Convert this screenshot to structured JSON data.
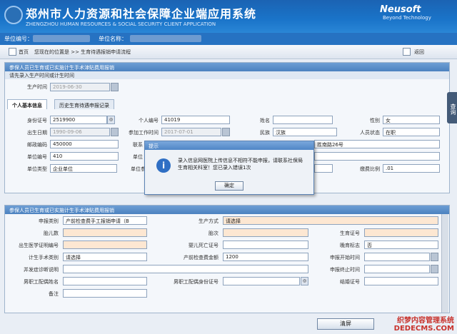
{
  "header": {
    "title_cn": "郑州市人力资源和社会保障企业端应用系统",
    "title_en": "ZHENGZHOU HUMAN RESOURCES & SOCIAL SECURITY CLIENT APPLICATION",
    "logo_name": "Neusoft",
    "logo_slogan": "Beyond Technology"
  },
  "unitbar": {
    "unit_no_label": "单位编号：",
    "unit_name_label": "单位名称："
  },
  "nav": {
    "home": "首页",
    "location": "您现在的位置是 >> 生育待遇报销申请流程",
    "back": "返回"
  },
  "top_panel": {
    "title": "参保人员已生育或已实施计生手术津贴费用报销",
    "sub": "请先录入生产时间或计生时间",
    "birth_time_label": "生产时间",
    "birth_time_value": "2019-06-30"
  },
  "tabs": {
    "basic": "个人基本信息",
    "history": "历史生育待遇申报记录"
  },
  "basic": {
    "id_label": "身份证号",
    "id_value": "2519900",
    "pno_label": "个人编号",
    "pno_value": "41019",
    "name_label": "姓名",
    "gender_label": "性别",
    "gender_value": "女",
    "dob_label": "出生日期",
    "dob_value": "1990-09-06",
    "work_label": "参加工作时间",
    "work_value": "2017-07-01",
    "nation_label": "民族",
    "nation_value": "汉族",
    "status_label": "人员状态",
    "status_value": "在职",
    "zip_label": "邮政编码",
    "zip_value": "450000",
    "contact_label": "联系",
    "addr_value": "胜南路26号",
    "unitno_label": "单位编号",
    "unitno_value": "410",
    "unitn_label": "单位",
    "unittype_label": "单位类型",
    "unittype_value": "企业单位",
    "unitpay_label": "单位参",
    "payratio_label": "缴费比例",
    "payratio_value": ".01"
  },
  "dialog": {
    "title": "提示",
    "message": "录入信息网医院上传信息不相符不能申报，请联系社保局生育相关科室！您已录入错误1次",
    "ok": "确定"
  },
  "bottom_panel": {
    "title": "参保人员已生育或已实施计生手术津贴费用报销",
    "r1": {
      "l1": "申报类别",
      "v1": "产前检查费手工报销申请（B",
      "l2": "生产方式",
      "v2": "请选择"
    },
    "r2": {
      "l1": "胎儿数",
      "l2": "胎次",
      "l3": "生育证号"
    },
    "r3": {
      "l1": "出生医学证明编号",
      "l2": "婴儿死亡证号",
      "l3": "晚育标志",
      "v3": "否"
    },
    "r4": {
      "l1": "计生手术类别",
      "v1": "请选择",
      "l2": "产前检查费金额",
      "v2": "1200",
      "l3": "申报开始时间"
    },
    "r5": {
      "l1": "并发症诊断说明",
      "l3": "申报终止时间"
    },
    "r6": {
      "l1": "男职工配偶姓名",
      "l2": "男职工配偶身份证号",
      "l3": "结婚证号"
    },
    "r7": {
      "l1": "备注"
    }
  },
  "side_button": "查询",
  "clear_button": "清屏",
  "watermark_line1": "织梦内容管理系统",
  "watermark_line2": "DEDECMS.COM"
}
